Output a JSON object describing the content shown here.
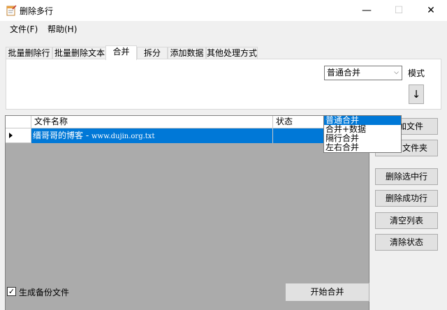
{
  "window": {
    "title": "删除多行",
    "minimize": "—",
    "maximize": "☐",
    "close": "✕"
  },
  "menu": [
    "文件(F)",
    "帮助(H)"
  ],
  "tabs": [
    {
      "label": "批量删除行",
      "active": false
    },
    {
      "label": "批量删除文本",
      "active": false
    },
    {
      "label": "合并",
      "active": true
    },
    {
      "label": "拆分",
      "active": false
    },
    {
      "label": "添加数据",
      "active": false
    },
    {
      "label": "其他处理方式",
      "active": false
    }
  ],
  "merge": {
    "mode_value": "普通合并",
    "mode_label": "模式",
    "arrow": "↓",
    "options": [
      "普通合并",
      "合并+数据",
      "隔行合并",
      "左右合并"
    ],
    "selected_index": 0
  },
  "grid": {
    "columns": [
      "文件名称",
      "状态"
    ],
    "rows": [
      {
        "name_prefix": "缙哥哥的博客 - ",
        "name_mono": "www.dujin.org.txt",
        "status": ""
      }
    ]
  },
  "side_buttons": [
    "添加文件",
    "添加文件夹",
    "删除选中行",
    "删除成功行",
    "清空列表",
    "清除状态"
  ],
  "backup": {
    "label": "生成备份文件",
    "checked": true,
    "mark": "✓"
  },
  "start_button": "开始合并",
  "colors": {
    "accent": "#0078d7",
    "grid_bg": "#ababab",
    "chrome": "#f0f0f0"
  }
}
